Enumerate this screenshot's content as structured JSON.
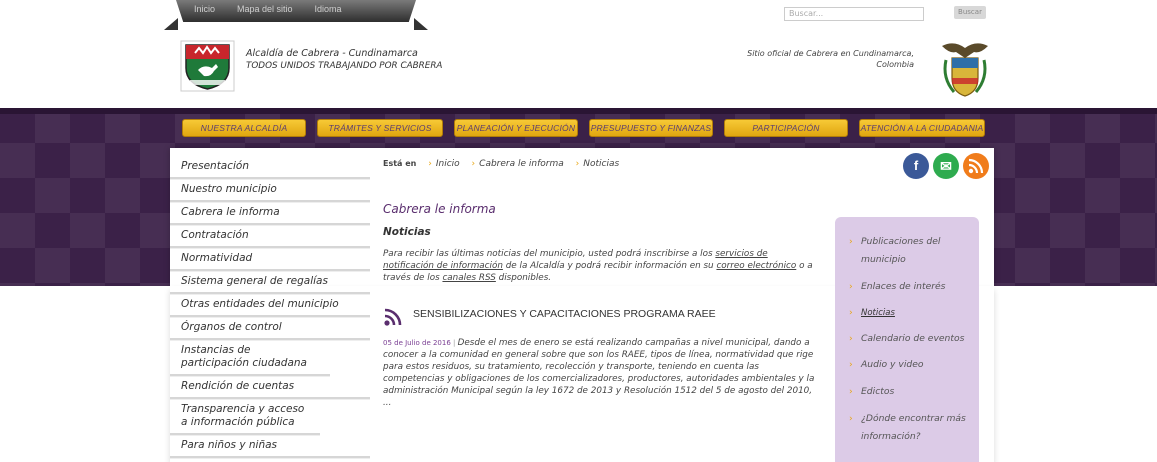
{
  "top_links": [
    "Inicio",
    "Mapa del sitio",
    "Idioma"
  ],
  "search": {
    "placeholder": "Buscar...",
    "button": "Buscar"
  },
  "header": {
    "title": "Alcaldía de Cabrera - Cundinamarca",
    "subtitle": "TODOS UNIDOS TRABAJANDO POR CABRERA",
    "official_line1": "Sitio oficial de Cabrera en Cundinamarca,",
    "official_line2": "Colombia"
  },
  "nav": [
    "NUESTRA ALCALDÍA",
    "TRÁMITES Y SERVICIOS",
    "PLANEACIÓN Y EJECUCIÓN",
    "PRESUPUESTO Y FINANZAS",
    "PARTICIPACIÓN",
    "ATENCIÓN A LA CIUDADANIA"
  ],
  "sidebar": [
    "Presentación",
    "Nuestro municipio",
    "Cabrera le informa",
    "Contratación",
    "Normatividad",
    "Sistema general de regalías",
    "Otras entidades del municipio",
    "Órganos de control",
    "Instancias de participación ciudadana",
    "Rendición de cuentas",
    "Transparencia y acceso a información pública",
    "Para niños y niñas"
  ],
  "breadcrumb": {
    "label": "Está en",
    "items": [
      "Inicio",
      "Cabrera le informa",
      "Noticias"
    ]
  },
  "social": {
    "facebook": "f",
    "email": "✉",
    "rss": "rss"
  },
  "main": {
    "title": "Cabrera le informa",
    "section": "Noticias",
    "intro_part1": "Para recibir las últimas noticias del municipio, usted podrá inscribirse a los ",
    "intro_link1": "servicios de notificación de información",
    "intro_part2": " de la Alcaldía y podrá recibir información en su ",
    "intro_link2": "correo electrónico",
    "intro_part3": " o a través de los ",
    "intro_link3": "canales RSS",
    "intro_part4": " disponibles."
  },
  "news": {
    "title": "SENSIBILIZACIONES Y CAPACITACIONES PROGRAMA RAEE",
    "date": "05 de Julio de 2016",
    "separator": " | ",
    "body": "Desde el mes de enero se está realizando campañas a nivel municipal, dando a conocer a la comunidad en general sobre que son los RAEE, tipos de línea, normatividad que rige para estos residuos, su tratamiento, recolección y transporte, teniendo en cuenta las competencias y obligaciones de los comercializadores, productores, autoridades ambientales y la administración Municipal según la ley 1672 de 2013 y Resolución 1512 del 5 de agosto del 2010, ..."
  },
  "right_menu": [
    "Publicaciones del municipio",
    "Enlaces de interés",
    "Noticias",
    "Calendario de eventos",
    "Audio y video",
    "Edictos",
    "¿Dónde encontrar más información?"
  ],
  "colors": {
    "purple_band": "#3b2148",
    "nav_gold": "#f2bd2a",
    "accent_purple": "#5a2e6e",
    "right_box": "#dccbe7",
    "arrow_gold": "#e8a614"
  }
}
